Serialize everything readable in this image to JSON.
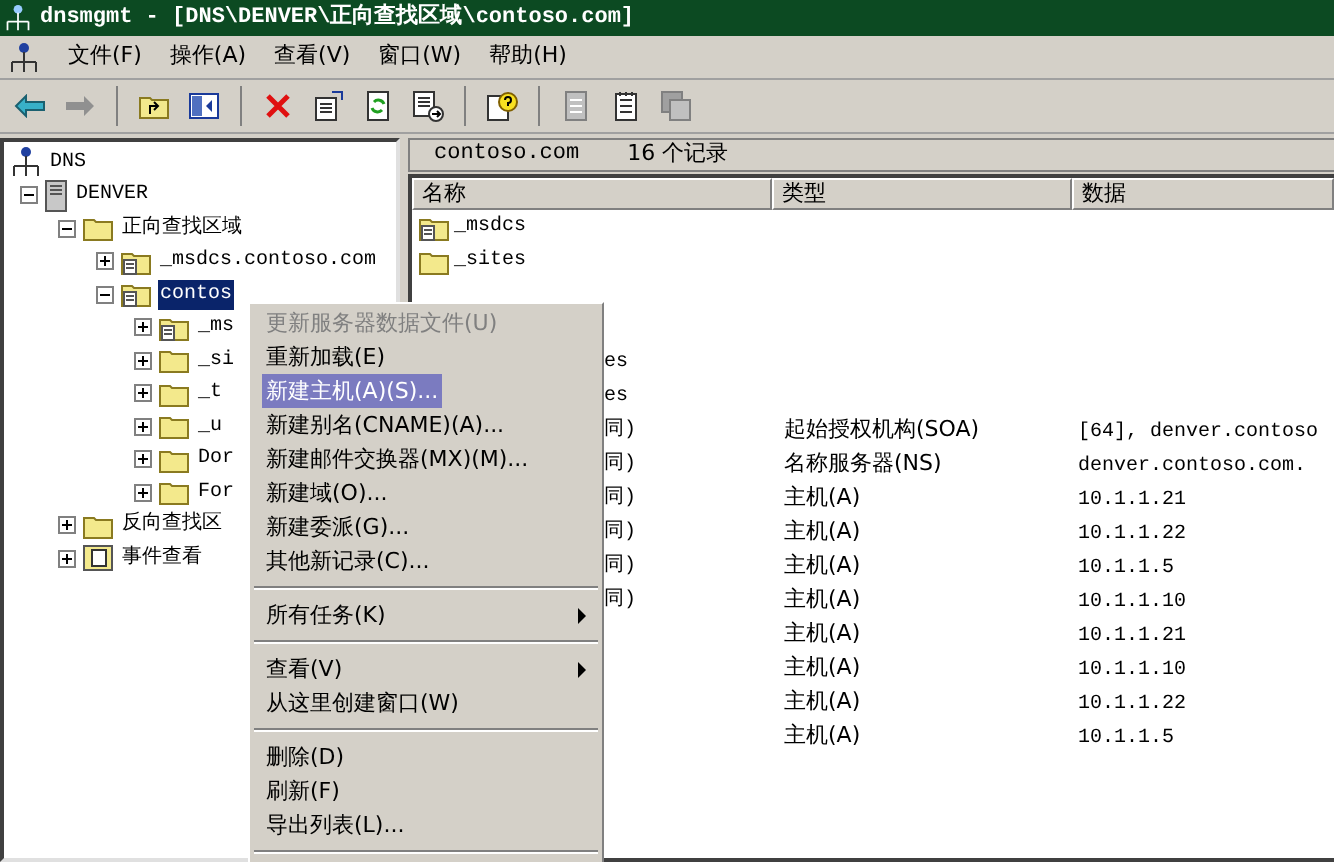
{
  "window": {
    "title": "dnsmgmt - [DNS\\DENVER\\正向查找区域\\contoso.com]"
  },
  "menu_bar": [
    "文件(F)",
    "操作(A)",
    "查看(V)",
    "窗口(W)",
    "帮助(H)"
  ],
  "tree": [
    {
      "label": "DNS",
      "kind": "dns",
      "selected": false,
      "children": [
        {
          "label": "DENVER",
          "kind": "server",
          "expanded": true,
          "selected": false,
          "children": [
            {
              "label": "正向查找区域",
              "kind": "folder",
              "expanded": true,
              "selected": false,
              "children": [
                {
                  "label": "_msdcs.contoso.com",
                  "kind": "zone",
                  "expanded": false,
                  "selected": false
                },
                {
                  "label": "contos",
                  "kind": "zone",
                  "expanded": true,
                  "selected": true,
                  "children": [
                    {
                      "label": "_ms",
                      "kind": "zone",
                      "expanded": false,
                      "selected": false
                    },
                    {
                      "label": "_si",
                      "kind": "folder",
                      "expanded": false,
                      "selected": false
                    },
                    {
                      "label": "_t",
                      "kind": "folder",
                      "expanded": false,
                      "selected": false
                    },
                    {
                      "label": "_u",
                      "kind": "folder",
                      "expanded": false,
                      "selected": false
                    },
                    {
                      "label": "Dor",
                      "kind": "folder",
                      "expanded": false,
                      "selected": false
                    },
                    {
                      "label": "For",
                      "kind": "folder",
                      "expanded": false,
                      "selected": false
                    }
                  ]
                }
              ]
            },
            {
              "label": "反向查找区",
              "kind": "folder",
              "expanded": false,
              "selected": false
            },
            {
              "label": "事件查看",
              "kind": "log",
              "expanded": false,
              "selected": false
            }
          ]
        }
      ]
    }
  ],
  "list_header": {
    "zone": "contoso.com",
    "count": "16 个记录"
  },
  "table": {
    "columns": [
      "名称",
      "类型",
      "数据"
    ],
    "rows": [
      {
        "kind": "zone",
        "name": "_msdcs"
      },
      {
        "kind": "folder",
        "name": "_sites"
      },
      {
        "kind": "hidden"
      },
      {
        "kind": "hidden"
      },
      {
        "kind": "covered",
        "name": "es"
      },
      {
        "kind": "covered",
        "name": "es"
      },
      {
        "kind": "covered",
        "name": "同)",
        "type": "起始授权机构(SOA)",
        "data": "[64], denver.contoso"
      },
      {
        "kind": "covered",
        "name": "同)",
        "type": "名称服务器(NS)",
        "data": "denver.contoso.com."
      },
      {
        "kind": "covered",
        "name": "同)",
        "type": "主机(A)",
        "data": "10.1.1.21"
      },
      {
        "kind": "covered",
        "name": "同)",
        "type": "主机(A)",
        "data": "10.1.1.22"
      },
      {
        "kind": "covered",
        "name": "同)",
        "type": "主机(A)",
        "data": "10.1.1.5"
      },
      {
        "kind": "covered",
        "name": "同)",
        "type": "主机(A)",
        "data": "10.1.1.10"
      },
      {
        "kind": "covered",
        "type": "主机(A)",
        "data": "10.1.1.21"
      },
      {
        "kind": "covered",
        "type": "主机(A)",
        "data": "10.1.1.10"
      },
      {
        "kind": "covered",
        "type": "主机(A)",
        "data": "10.1.1.22"
      },
      {
        "kind": "covered",
        "type": "主机(A)",
        "data": "10.1.1.5"
      }
    ]
  },
  "context_menu": [
    {
      "kind": "item",
      "label": "更新服务器数据文件(U)",
      "disabled": true,
      "selected": false
    },
    {
      "kind": "item",
      "label": "重新加载(E)",
      "disabled": false,
      "selected": false
    },
    {
      "kind": "item",
      "label": "新建主机(A)(S)...",
      "disabled": false,
      "selected": true
    },
    {
      "kind": "item",
      "label": "新建别名(CNAME)(A)...",
      "disabled": false,
      "selected": false
    },
    {
      "kind": "item",
      "label": "新建邮件交换器(MX)(M)...",
      "disabled": false,
      "selected": false
    },
    {
      "kind": "item",
      "label": "新建域(O)...",
      "disabled": false,
      "selected": false
    },
    {
      "kind": "item",
      "label": "新建委派(G)...",
      "disabled": false,
      "selected": false
    },
    {
      "kind": "item",
      "label": "其他新记录(C)...",
      "disabled": false,
      "selected": false
    },
    {
      "kind": "separator"
    },
    {
      "kind": "submenu",
      "label": "所有任务(K)",
      "disabled": false,
      "selected": false
    },
    {
      "kind": "separator"
    },
    {
      "kind": "submenu",
      "label": "查看(V)",
      "disabled": false,
      "selected": false
    },
    {
      "kind": "item",
      "label": "从这里创建窗口(W)",
      "disabled": false,
      "selected": false
    },
    {
      "kind": "separator"
    },
    {
      "kind": "item",
      "label": "删除(D)",
      "disabled": false,
      "selected": false
    },
    {
      "kind": "item",
      "label": "刷新(F)",
      "disabled": false,
      "selected": false
    },
    {
      "kind": "item",
      "label": "导出列表(L)...",
      "disabled": false,
      "selected": false
    },
    {
      "kind": "separator"
    }
  ]
}
